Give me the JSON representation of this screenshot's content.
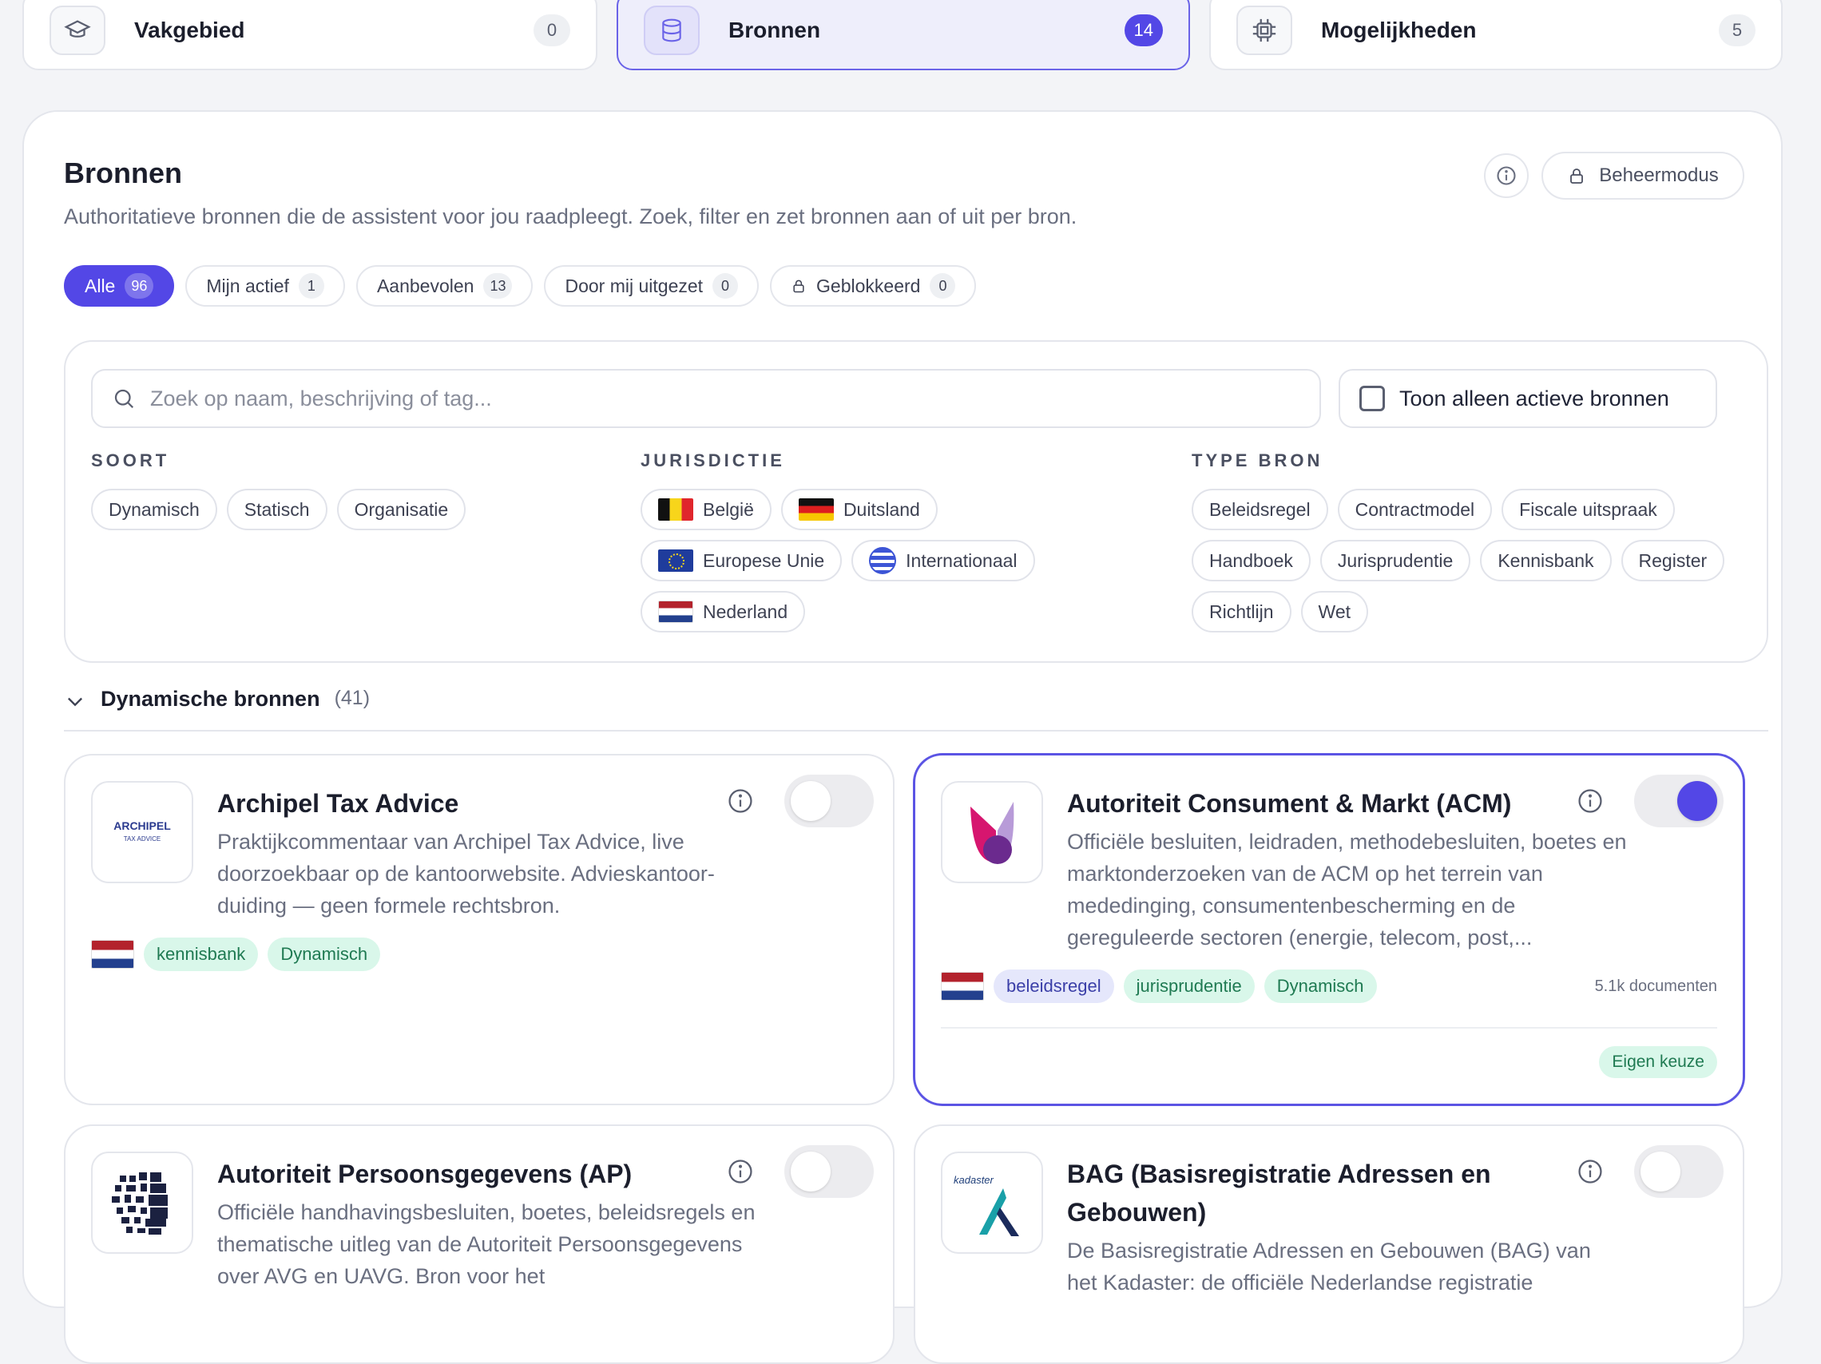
{
  "top_tabs": [
    {
      "label": "Vakgebied",
      "count": "0",
      "icon": "graduation-cap-icon"
    },
    {
      "label": "Bronnen",
      "count": "14",
      "icon": "database-icon"
    },
    {
      "label": "Mogelijkheden",
      "count": "5",
      "icon": "chip-icon"
    }
  ],
  "header": {
    "title": "Bronnen",
    "subtitle": "Authoritatieve bronnen die de assistent voor jou raadpleegt. Zoek, filter en zet bronnen aan of uit per bron.",
    "beheer_label": "Beheermodus"
  },
  "filter_tabs": [
    {
      "label": "Alle",
      "count": "96",
      "active": true
    },
    {
      "label": "Mijn actief",
      "count": "1"
    },
    {
      "label": "Aanbevolen",
      "count": "13"
    },
    {
      "label": "Door mij uitgezet",
      "count": "0"
    },
    {
      "label": "Geblokkeerd",
      "count": "0",
      "icon": "lock-icon"
    }
  ],
  "search": {
    "placeholder": "Zoek op naam, beschrijving of tag..."
  },
  "only_active_label": "Toon alleen actieve bronnen",
  "filters": {
    "soort": {
      "heading": "SOORT",
      "options": [
        "Dynamisch",
        "Statisch",
        "Organisatie"
      ]
    },
    "jurisdictie": {
      "heading": "JURISDICTIE",
      "options": [
        "België",
        "Duitsland",
        "Europese Unie",
        "Internationaal",
        "Nederland"
      ]
    },
    "type_bron": {
      "heading": "TYPE BRON",
      "options": [
        "Beleidsregel",
        "Contractmodel",
        "Fiscale uitspraak",
        "Handboek",
        "Jurisprudentie",
        "Kennisbank",
        "Register",
        "Richtlijn",
        "Wet"
      ]
    }
  },
  "section": {
    "name": "Dynamische bronnen",
    "count": "(41)"
  },
  "cards": [
    {
      "name": "Archipel Tax Advice",
      "logo_text": "ARCHIPEL",
      "logo_sub": "TAX ADVICE",
      "description": "Praktijkcommentaar van Archipel Tax Advice, live doorzoekbaar op de kantoorwebsite. Advieskantoor-duiding — geen formele rechtsbron.",
      "tags": [
        "kennisbank",
        "Dynamisch"
      ],
      "enabled": false
    },
    {
      "name": "Autoriteit Consument & Markt (ACM)",
      "description": "Officiële besluiten, leidraden, methodebesluiten, boetes en marktonderzoeken van de ACM op het terrein van mededinging, consumentenbescherming en de gereguleerde sectoren (energie, telecom, post,...",
      "tags": [
        "beleidsregel",
        "jurisprudentie",
        "Dynamisch"
      ],
      "doc_count": "5.1k documenten",
      "badge": "Eigen keuze",
      "enabled": true
    },
    {
      "name": "Autoriteit Persoonsgegevens (AP)",
      "description": "Officiële handhavingsbesluiten, boetes, beleidsregels en thematische uitleg van de Autoriteit Persoonsgegevens over AVG en UAVG. Bron voor het",
      "enabled": false
    },
    {
      "name": "BAG (Basisregistratie Adressen en Gebouwen)",
      "logo_text": "kadaster",
      "description": "De Basisregistratie Adressen en Gebouwen (BAG) van het Kadaster: de officiële Nederlandse registratie",
      "enabled": false
    }
  ],
  "colors": {
    "accent": "#5347e6",
    "green_tag_bg": "#d9f7ea",
    "blue_tag_bg": "#e5e7fb"
  }
}
